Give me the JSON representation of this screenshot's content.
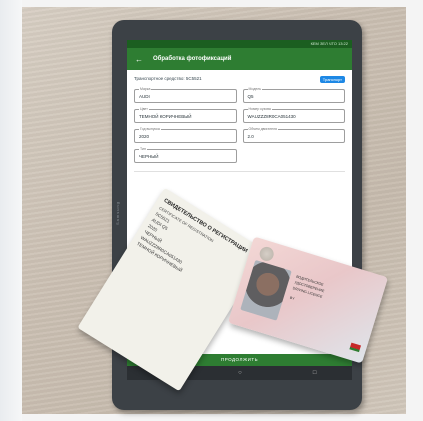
{
  "app": {
    "title": "Обработка фотофиксаций",
    "status_text": "КЕМ ЗЕЛ ЧТО 13:22"
  },
  "vehicle": {
    "label": "Транспортное средство: 5С5521",
    "badge": "Транспорт"
  },
  "fields": [
    {
      "label": "Марка",
      "value": "AUDI"
    },
    {
      "label": "Модель",
      "value": "Q5"
    },
    {
      "label": "Цвет",
      "value": "ТЕМНОЙ КОРИЧНЕВЫЙ"
    },
    {
      "label": "Номер кузова",
      "value": "WAUZZZ8R0CA051430"
    },
    {
      "label": "Год выпуска",
      "value": "2020"
    },
    {
      "label": "Объем двигателя",
      "value": "2.0"
    },
    {
      "label": "Тип",
      "value": "ЧЕРНЫЙ"
    }
  ],
  "button": {
    "continue_label": "ПРОДОЛЖИТЬ"
  },
  "nav": {
    "back": "◁",
    "home": "○",
    "recent": "□"
  },
  "brand_text": "Samsung",
  "card1": {
    "title": "СВИДЕТЕЛЬСТВО О РЕГИСТРАЦИИ",
    "subtitle": "CERTIFICATE OF REGISTRATION",
    "lines": [
      "5С5521",
      "AUDI Q5",
      "2020",
      "ЧЕРНЫЙ",
      "WAUZZZ8R0CA051430",
      "ТЕМНОЙ КОРИЧНЕВЫЙ"
    ]
  },
  "card2": {
    "lines": [
      "ВОДИТЕЛЬСКОЕ",
      "УДОСТОВЕРЕНИЕ",
      "DRIVING LICENCE",
      "BY"
    ]
  }
}
